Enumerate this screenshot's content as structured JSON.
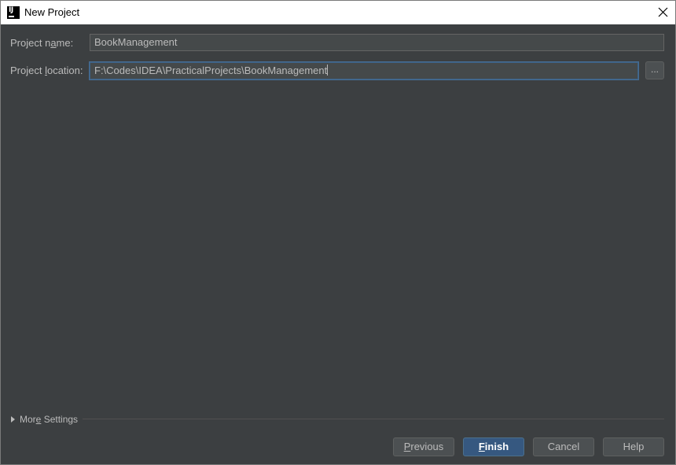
{
  "window": {
    "title": "New Project",
    "app_icon": "intellij-idea-icon",
    "close_icon": "close-icon"
  },
  "form": {
    "project_name": {
      "label_pre": "Project n",
      "label_mnemonic": "a",
      "label_post": "me:",
      "value": "BookManagement"
    },
    "project_location": {
      "label_pre": "Project ",
      "label_mnemonic": "l",
      "label_post": "ocation:",
      "value": "F:\\Codes\\IDEA\\PracticalProjects\\BookManagement",
      "browse_label": "..."
    }
  },
  "more_settings": {
    "label_pre": "Mor",
    "label_mnemonic": "e",
    "label_post": " Settings",
    "icon": "triangle-right-icon"
  },
  "buttons": {
    "previous": {
      "mnemonic": "P",
      "rest": "revious"
    },
    "finish": {
      "mnemonic": "F",
      "rest": "inish"
    },
    "cancel": {
      "label": "Cancel"
    },
    "help": {
      "label": "Help"
    }
  },
  "colors": {
    "background": "#3c3f41",
    "field_background": "#45494a",
    "text": "#bbbbbb",
    "primary_button": "#365880",
    "focus_border": "#466d94"
  }
}
